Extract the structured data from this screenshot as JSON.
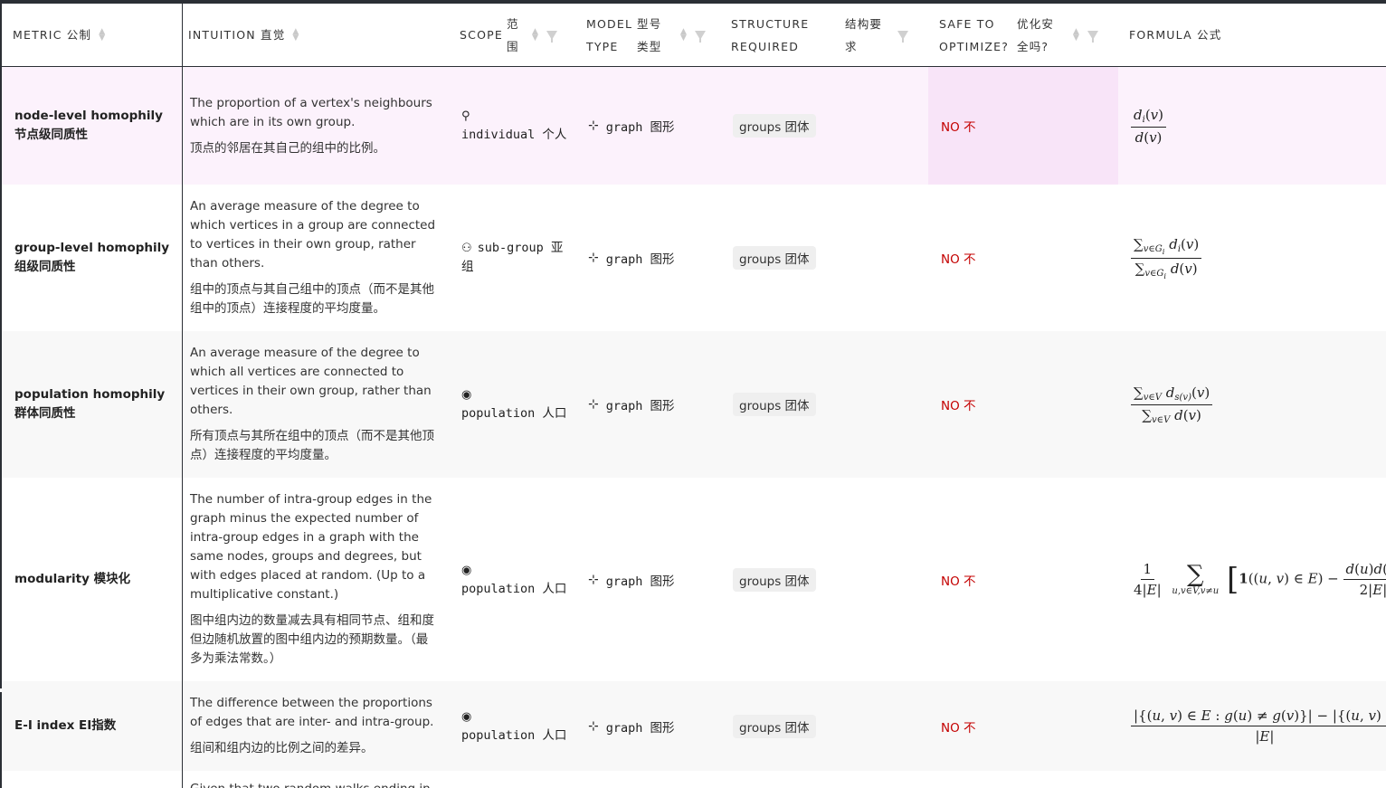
{
  "headers": {
    "metric": "METRIC 公制",
    "intuition": "INTUITION 直觉",
    "scope_en": "SCOPE",
    "scope_cn": "范围",
    "model_en": "MODEL TYPE",
    "model_cn": "型号 类型",
    "structure_en": "STRUCTURE REQUIRED",
    "structure_cn": "结构要求",
    "safe_en": "SAFE TO OPTIMIZE?",
    "safe_cn": "优化安全吗?",
    "formula": "FORMULA 公式"
  },
  "rows": [
    {
      "metric": "node-level homophily 节点级同质性",
      "intuition_en": "The proportion of a vertex's neighbours which are in its own group.",
      "intuition_cn": "顶点的邻居在其自己的组中的比例。",
      "scope_icon": "person-icon",
      "scope": "individual 个人",
      "model_icon": "graph-icon",
      "model": "graph 图形",
      "structure": "groups 团体",
      "safe": "NO 不"
    },
    {
      "metric": "group-level homophily 组级同质性",
      "intuition_en": "An average measure of the degree to which vertices in a group are connected to vertices in their own group, rather than others.",
      "intuition_cn": "组中的顶点与其自己组中的顶点（而不是其他组中的顶点）连接程度的平均度量。",
      "scope_icon": "group-icon",
      "scope": "sub-group 亚组",
      "model_icon": "graph-icon",
      "model": "graph 图形",
      "structure": "groups 团体",
      "safe": "NO 不"
    },
    {
      "metric": "population homophily 群体同质性",
      "intuition_en": "An average measure of the degree to which all vertices are connected to vertices in their own group, rather than others.",
      "intuition_cn": "所有顶点与其所在组中的顶点（而不是其他顶点）连接程度的平均度量。",
      "scope_icon": "globe-icon",
      "scope": "population 人口",
      "model_icon": "graph-icon",
      "model": "graph 图形",
      "structure": "groups 团体",
      "safe": "NO 不"
    },
    {
      "metric": "modularity 模块化",
      "intuition_en": "The number of intra-group edges in the graph minus the expected number of intra-group edges in a graph with the same nodes, groups and degrees, but with edges placed at random. (Up to a multiplicative constant.)",
      "intuition_cn": "图中组内边的数量减去具有相同节点、组和度但边随机放置的图中组内边的预期数量。（最多为乘法常数。）",
      "scope_icon": "globe-icon",
      "scope": "population 人口",
      "model_icon": "graph-icon",
      "model": "graph 图形",
      "structure": "groups 团体",
      "safe": "NO 不"
    },
    {
      "metric": "E-I index EI指数",
      "intuition_en": "The difference between the proportions of edges that are inter- and intra-group.",
      "intuition_cn": "组间和组内边的比例之间的差异。",
      "scope_icon": "globe-icon",
      "scope": "population 人口",
      "model_icon": "graph-icon",
      "model": "graph 图形",
      "structure": "groups 团体",
      "safe": "NO 不"
    }
  ],
  "partial_row_text": "Given that two random walks ending in"
}
